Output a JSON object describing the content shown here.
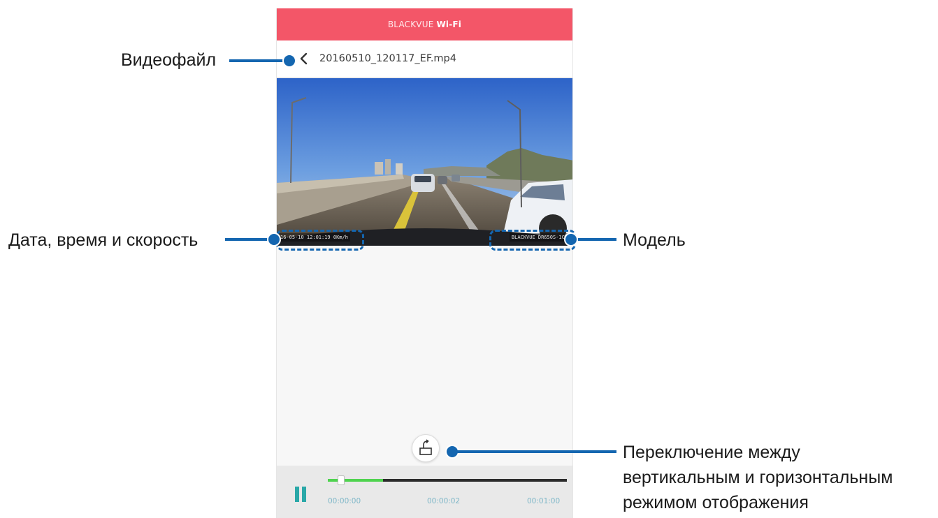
{
  "app": {
    "title_prefix": "BLACKVUE",
    "title_suffix": "Wi-Fi",
    "filename": "20160510_120117_EF.mp4"
  },
  "video": {
    "overlay_datetime_speed": "16-05-10 12:01:19 0Km/h",
    "overlay_model": "BLACKVUE DR650S-1CH"
  },
  "player": {
    "progress": 0.23,
    "thumb_position": 0.04,
    "time_start": "00:00:00",
    "time_current": "00:00:02",
    "time_end": "00:01:00"
  },
  "callouts": {
    "video_file": "Видеофайл",
    "date_time_speed": "Дата, время и скорость",
    "model": "Модель",
    "orientation_line1": "Переключение между",
    "orientation_line2": "вертикальным и горизонтальным",
    "orientation_line3": "режимом отображения"
  },
  "colors": {
    "appbar": "#f35668",
    "callout_blue": "#1466b0",
    "progress_fill": "#4fd34f",
    "pause_icon": "#2aa8a8"
  }
}
